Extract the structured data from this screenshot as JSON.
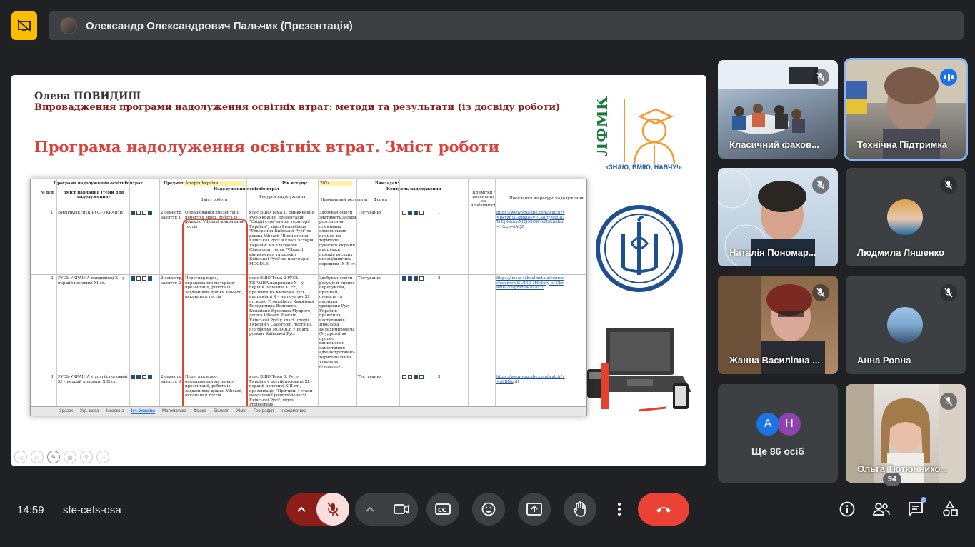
{
  "top_bar": {
    "presenter_name": "Олександр Олександрович Пальчик (Презентація)"
  },
  "slide": {
    "author": "Олена ПОВИДИШ",
    "topic": "Впровадження програми надолуження освітніх втрат: методи та результати (із досвіду роботи)",
    "title": "Програма надолуження освітніх втрат. Зміст роботи",
    "logo_text": "ЛФМК",
    "slogan": "«ЗНАЮ, ВМІЮ, НАВЧУ!»",
    "sheet": {
      "header_subject_label": "Предмет:",
      "header_subject_value": "Історія України",
      "header_year_label": "Рік вступу:",
      "header_year_value": "2024",
      "header_teacher_label": "Викладач:",
      "header_program": "Програма надолуження освітніх втрат",
      "header_col_num": "№ п/п",
      "header_col_content": "Зміст навчання (теми для надолуження)",
      "header_col_main": "Надолуження освітніх втрат",
      "header_col_control": "Контроль надолуження",
      "header_col_work": "Зміст роботи",
      "header_col_resources": "Ресурси надолуження",
      "header_col_result": "Навчальний результат",
      "header_col_form": "Форма",
      "header_col_notes": "Примітки / пояснення за необхідності",
      "header_col_links": "Посилання на ресурс надолуження",
      "rows": [
        {
          "num": "1",
          "topic": "ВИНИКНЕННЯ РУСІ-УКРАЇНИ",
          "semester": "2 семестр, заняття 1",
          "work": "Опрацювання презентації, перегляд відео, робота із дошкою Viboard, виконання тестів",
          "resources": "клас ВШО Тема 1. Виникнення Русі-України, презентація \"Східні слов'яни на території України\", відео Prometheus \"Утворення Київської Русі\" та дошка Viboard \"Виникнення Київської Русі\" в класі \"Історія України\" на платформі Classroom, тести \"Viboard виникнення та розквіт Київської Русі\" на платформі MOODLE",
          "result": "Здобувач освіти знатиметь засади розселення племінних слов'янських племен на території сучасної України; напрямки походів руських князів/княгинь середини IX–X ст.",
          "form": "Тестування",
          "score": "1",
          "link": "https://www.youtube.com/watch?v=bkvzE9lGbdklist=PLs8RyMf6uUTrUjXKuvy.XLIJS9OWvefU&index=1&pp=iAQB"
        },
        {
          "num": "2",
          "topic": "РУСЬ-УКРАЇНА наприкінці X – у першій половині XI ст.",
          "semester": "2 семестр, заняття 2",
          "work": "Перегляд відео, опрацювання матеріалу презентації, робота із завданнями дошки Viboard, виконання тестів",
          "resources": "клас ВШО Тема 2 РУСЬ-УКРАЇНА наприкінці X – у першій половині XI ст., презентація Київська Русь наприкінці X – на початку XI ст. відео Prometheus Княжіння Володимира Великого, Княжіння Ярослава Мудрого, дошка Viboard Розквіт Київської Русі у класі Історія України у Classroom, тести на платформі MOODLE Viboard розквіт Київської Русі",
          "result": "Здобувач освіти розуміє й оцінює передумови, причини, сутність та наслідки хрещення Русі-України; правління наступників Ярослава Володимировича (Мудрого) як процес виникнення самостійних адміністративно-територіальних утворень («земель»).",
          "form": "Тестування",
          "score": "2",
          "link": "https://lms.e-school.net.ua/courses/course-v1:UIED+History-of-Ukraine-7th-grade+2020_1"
        },
        {
          "num": "3",
          "topic": "РУСЬ-УКРАЇНА у другій половині XI – першій половині XIII ст.",
          "semester": "2 семестр, заняття 3",
          "work": "Перегляд відео, опрацювання матеріалу презентації, робота із завданнями дошки Viboard, виконання тестів",
          "resources": "клас ВШО Тема 3. Русь-Україна у другій половині XI – першій половині XIII ст., презентація \"Причини і етапи феодальної роздробленості Київської Русі\", відео Prometheus",
          "result": "",
          "form": "Тестування",
          "score": "3",
          "link": "https://www.youtube.com/watch?v=a0BNngIJ"
        }
      ],
      "tabs": [
        "Зразок",
        "Укр. мова",
        "Іноземна",
        "Іст. України",
        "Математика",
        "Фізика",
        "Біологія",
        "Хімія",
        "Географія",
        "Інформатика"
      ],
      "active_tab": "Іст. України"
    }
  },
  "participants": [
    {
      "name": "Класичний фахов...",
      "state": "muted"
    },
    {
      "name": "Технічна Підтримка",
      "state": "speaking"
    },
    {
      "name": "Наталія Пономар...",
      "state": "muted"
    },
    {
      "name": "Людмила Ляшенко",
      "state": "muted"
    },
    {
      "name": "Жанна Василівна ...",
      "state": "muted"
    },
    {
      "name": "Анна Ровна",
      "state": "muted"
    },
    {
      "name": "Ольга Тютюннико...",
      "state": "muted"
    }
  ],
  "more_tile": {
    "avatars": [
      "А",
      "Н"
    ],
    "label": "Ще 86 осіб"
  },
  "bottom_bar": {
    "time": "14:59",
    "meeting_code": "sfe-cefs-osa",
    "participant_count": "94"
  },
  "colors": {
    "accent": "#8ab4f8",
    "end_call": "#ea4335",
    "mic_off": "#f9dedc",
    "hide_button": "#fbbc04"
  }
}
